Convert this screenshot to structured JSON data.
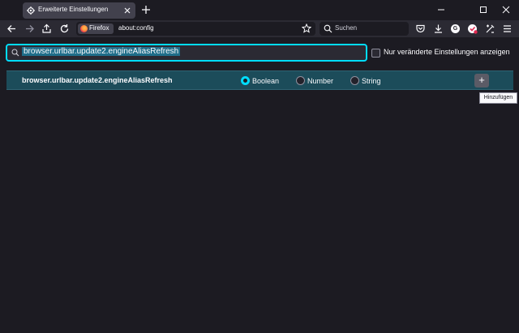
{
  "tab": {
    "title": "Erweiterte Einstellungen"
  },
  "nav": {
    "identity_label": "Firefox",
    "url": "about:config",
    "search_placeholder": "Suchen",
    "addon_badge_g": "G"
  },
  "config": {
    "search_value": "browser.urlbar.update2.engineAliasRefresh",
    "modified_only_label": "Nur veränderte Einstellungen anzeigen",
    "modified_only_checked": false,
    "new_pref": {
      "name": "browser.urlbar.update2.engineAliasRefresh",
      "types": [
        "Boolean",
        "Number",
        "String"
      ],
      "selected_type": "Boolean",
      "add_symbol": "+",
      "add_tooltip": "Hinzufügen"
    }
  },
  "colors": {
    "accent": "#00ddff",
    "row_highlight": "#1c4c5a",
    "background": "#1c1b22",
    "toolbar": "#2b2a33"
  }
}
